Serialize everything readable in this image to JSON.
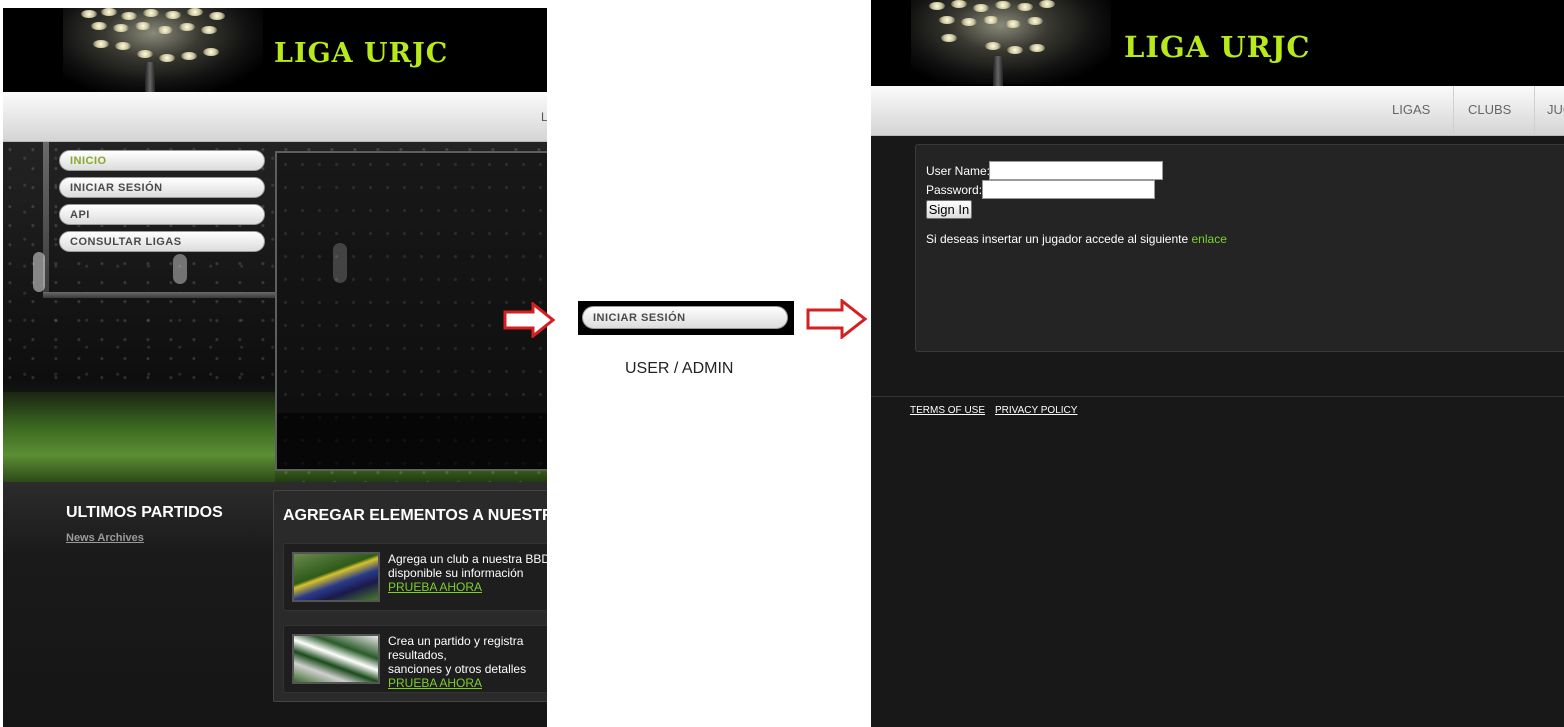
{
  "left": {
    "logo": "LIGA URJC",
    "nav_partial": "L",
    "menu": [
      {
        "label": "INICIO",
        "active": true
      },
      {
        "label": "INICIAR SESIÓN",
        "active": false
      },
      {
        "label": "API",
        "active": false
      },
      {
        "label": "CONSULTAR LIGAS",
        "active": false
      }
    ],
    "sidebar_title": "ULTIMOS PARTIDOS",
    "news_link": "News Archives",
    "box_title": "AGREGAR ELEMENTOS A NUESTRA",
    "cards": [
      {
        "line1": "Agrega un club a nuestra BBDD",
        "line2": "disponible su información",
        "link": "PRUEBA AHORA"
      },
      {
        "line1": "Crea un partido y registra resultados,",
        "line2": "sanciones y otros detalles",
        "link": "PRUEBA AHORA"
      }
    ]
  },
  "middle": {
    "button_label": "INICIAR SESIÓN",
    "caption": "USER / ADMIN",
    "arrow_color": "#d42020"
  },
  "right": {
    "logo": "LIGA URJC",
    "nav": [
      "LIGAS",
      "CLUBS",
      "JUGADORES"
    ],
    "user_label": "User Name:",
    "password_label": "Password:",
    "user_value": "",
    "password_value": "",
    "signin_label": "Sign In",
    "info_text": "Si deseas insertar un jugador accede al siguiente ",
    "info_link": "enlace",
    "footer_links": [
      "TERMS OF USE",
      "PRIVACY POLICY"
    ]
  },
  "colors": {
    "logo": "#b8ea1b",
    "link_green": "#7bd12a",
    "active_menu": "#87a82a"
  }
}
